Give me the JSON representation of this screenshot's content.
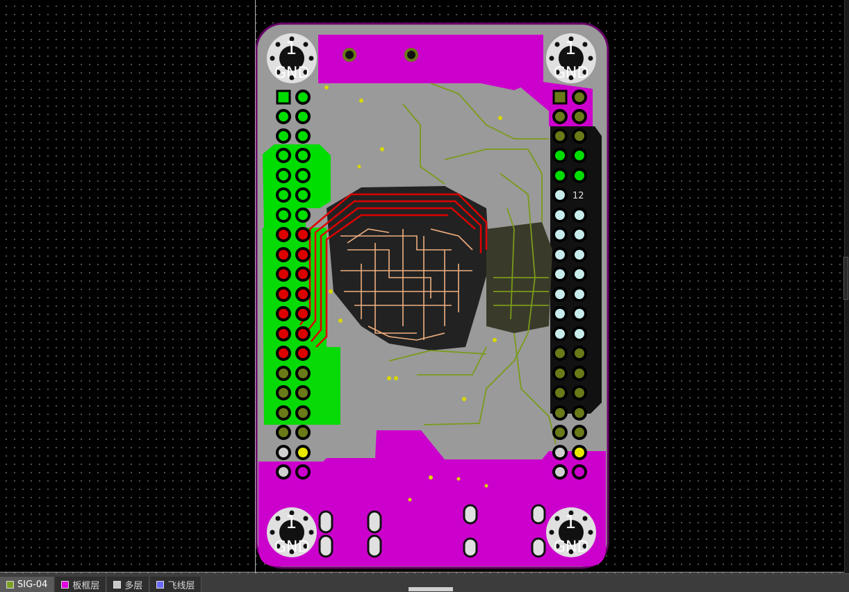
{
  "layers": {
    "tabs": [
      {
        "label": "SIG-04",
        "color": "#7aa020",
        "active": true
      },
      {
        "label": "板框层",
        "color": "#e000e0",
        "active": false
      },
      {
        "label": "多层",
        "color": "#c8c8c8",
        "active": false
      },
      {
        "label": "飞线层",
        "color": "#6a6aff",
        "active": false
      }
    ]
  },
  "board": {
    "mounting_holes": [
      {
        "number": "1",
        "net": "GND"
      },
      {
        "number": "1",
        "net": "GND"
      },
      {
        "number": "1",
        "net": "GND"
      },
      {
        "number": "1",
        "net": "GND"
      }
    ],
    "pin_label": "12"
  },
  "colors": {
    "background": "#000000",
    "board_fill": "#9a9a9a",
    "copper_magenta": "#cc00cc",
    "copper_green": "#00dd00",
    "trace_olive": "#7a9a1a",
    "trace_red": "#dd0000",
    "trace_salmon": "#f0b080"
  }
}
